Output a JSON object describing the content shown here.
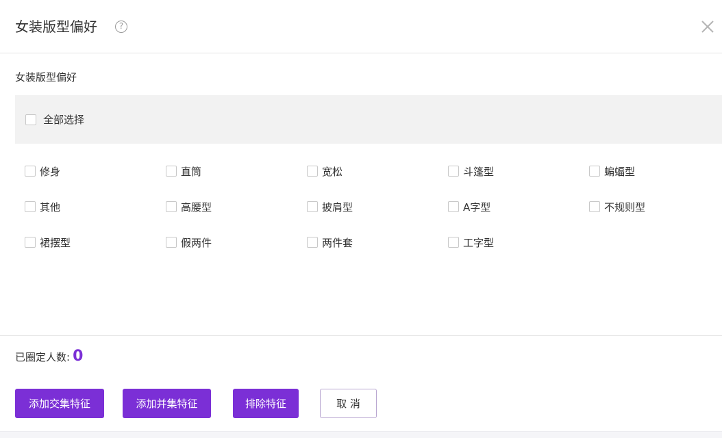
{
  "dialog": {
    "title": "女装版型偏好",
    "help_icon": "question-circle-icon",
    "close_icon": "close-icon",
    "close_glyph": "✕",
    "help_glyph": "?"
  },
  "section": {
    "title": "女装版型偏好",
    "select_all_label": "全部选择"
  },
  "options": [
    "修身",
    "直筒",
    "宽松",
    "斗篷型",
    "蝙蝠型",
    "其他",
    "高腰型",
    "披肩型",
    "A字型",
    "不规则型",
    "裙摆型",
    "假两件",
    "两件套",
    "工字型"
  ],
  "footer": {
    "fixed_count_label": "已圈定人数:",
    "fixed_count_value": "0",
    "add_intersection_label": "添加交集特征",
    "add_union_label": "添加并集特征",
    "exclude_label": "排除特征",
    "cancel_label": "取 消"
  },
  "colors": {
    "accent": "#7b2fd6",
    "select_all_bg": "#f2f2f2",
    "divider": "#e4e4e4"
  }
}
